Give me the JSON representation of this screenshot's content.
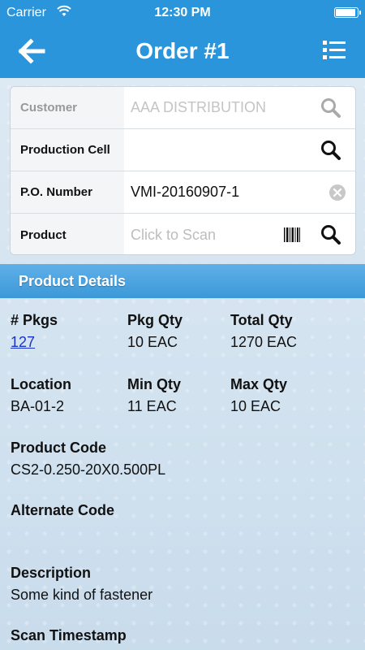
{
  "status_bar": {
    "carrier": "Carrier",
    "time": "12:30 PM"
  },
  "nav": {
    "title": "Order #1",
    "back_icon": "arrow-left-icon",
    "menu_icon": "list-icon"
  },
  "form": {
    "customer": {
      "label": "Customer",
      "value": "AAA DISTRIBUTION"
    },
    "production_cell": {
      "label": "Production Cell",
      "value": ""
    },
    "po_number": {
      "label": "P.O. Number",
      "value": "VMI-20160907-1"
    },
    "product": {
      "label": "Product",
      "placeholder": "Click to Scan"
    }
  },
  "section": {
    "title": "Product Details"
  },
  "details": {
    "pkgs": {
      "label": "# Pkgs",
      "value": "127"
    },
    "pkg_qty": {
      "label": "Pkg Qty",
      "value": "10 EAC"
    },
    "total_qty": {
      "label": "Total Qty",
      "value": "1270 EAC"
    },
    "location": {
      "label": "Location",
      "value": "BA-01-2"
    },
    "min_qty": {
      "label": "Min Qty",
      "value": "11 EAC"
    },
    "max_qty": {
      "label": "Max Qty",
      "value": "10 EAC"
    },
    "product_code": {
      "label": "Product Code",
      "value": "CS2-0.250-20X0.500PL"
    },
    "alternate_code": {
      "label": "Alternate Code",
      "value": ""
    },
    "description": {
      "label": "Description",
      "value": "Some kind of fastener"
    },
    "scan_timestamp": {
      "label": "Scan Timestamp",
      "value": ""
    }
  },
  "colors": {
    "bar": "#2a95db",
    "link": "#1a33c8"
  }
}
